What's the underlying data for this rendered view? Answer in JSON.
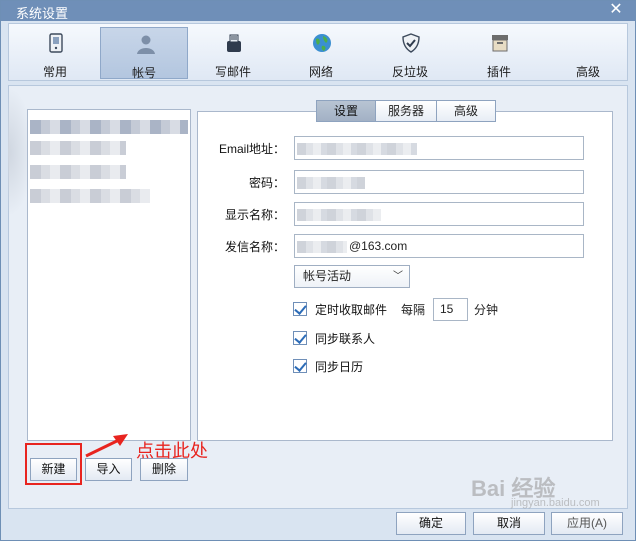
{
  "window": {
    "title": "系统设置",
    "close_glyph": "✕"
  },
  "toolbar": {
    "items": [
      {
        "label": "常用",
        "icon": "phone-icon"
      },
      {
        "label": "帐号",
        "icon": "user-icon"
      },
      {
        "label": "写邮件",
        "icon": "compose-icon"
      },
      {
        "label": "网络",
        "icon": "globe-icon"
      },
      {
        "label": "反垃圾",
        "icon": "shield-icon"
      },
      {
        "label": "插件",
        "icon": "box-icon"
      },
      {
        "label": "高级",
        "icon": ""
      }
    ],
    "active_index": 1
  },
  "settings_tabs": [
    {
      "label": "设置",
      "active": true
    },
    {
      "label": "服务器",
      "active": false
    },
    {
      "label": "高级",
      "active": false
    }
  ],
  "form": {
    "email_label": "Email地址：",
    "password_label": "密码：",
    "display_name_label": "显示名称：",
    "sender_name_label": "发信名称：",
    "sender_name_value": "@163.com",
    "status_select": "帐号活动",
    "fetch_mail_label": "定时收取邮件",
    "fetch_interval_prefix": "每隔",
    "fetch_interval_value": "15",
    "fetch_interval_unit": "分钟",
    "sync_contacts_label": "同步联系人",
    "sync_calendar_label": "同步日历"
  },
  "account_buttons": {
    "new": "新建",
    "import": "导入",
    "delete": "删除"
  },
  "dialog_buttons": {
    "ok": "确定",
    "cancel": "取消",
    "apply": "应用(A)"
  },
  "annotation": {
    "text": "点击此处",
    "color": "#e8241f"
  },
  "watermark": {
    "brand": "Bai 经验",
    "sub": "jingyan.baidu.com"
  },
  "colors": {
    "titlebar": "#6f8fb8",
    "accent": "#2c6cb8",
    "window_bg": "#d9e4f1"
  }
}
